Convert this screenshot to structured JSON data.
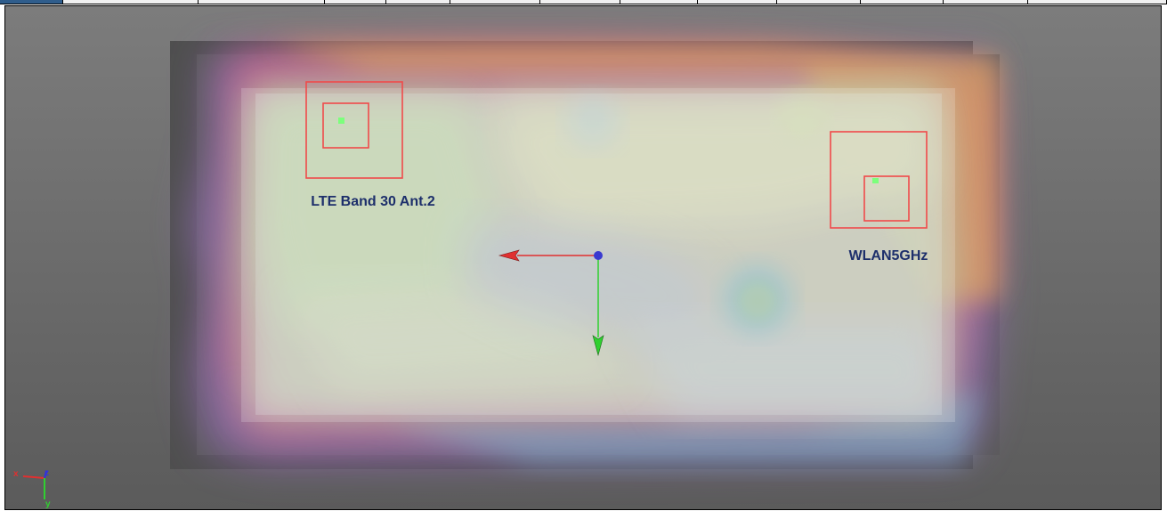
{
  "tabs": [
    {
      "label": "",
      "active": true
    },
    {
      "label": "",
      "active": false
    },
    {
      "label": "",
      "active": false
    },
    {
      "label": "",
      "active": false
    },
    {
      "label": "",
      "active": false
    },
    {
      "label": "",
      "active": false
    },
    {
      "label": "",
      "active": false
    },
    {
      "label": "",
      "active": false
    },
    {
      "label": "",
      "active": false
    },
    {
      "label": "",
      "active": false
    },
    {
      "label": "",
      "active": false
    },
    {
      "label": "",
      "active": false
    },
    {
      "label": "",
      "active": false
    }
  ],
  "viewport": {
    "background_colors": [
      "#7c7c7c",
      "#5b5b5b"
    ],
    "antennas": [
      {
        "label": "LTE Band 30 Ant.2",
        "box_color": "#f04a4a",
        "feed_color": "#7cff7c"
      },
      {
        "label": "WLAN5GHz",
        "box_color": "#f04a4a",
        "feed_color": "#7cff7c"
      }
    ],
    "origin_gizmo": {
      "x_axis_color": "#e03030",
      "y_axis_color": "#2fd02f",
      "origin_color": "#3a3ad0"
    },
    "axis_triad": {
      "x_label": "x",
      "y_label": "y",
      "z_label": "z",
      "x_color": "#e03030",
      "y_color": "#30d030",
      "z_color": "#3030e0"
    }
  }
}
